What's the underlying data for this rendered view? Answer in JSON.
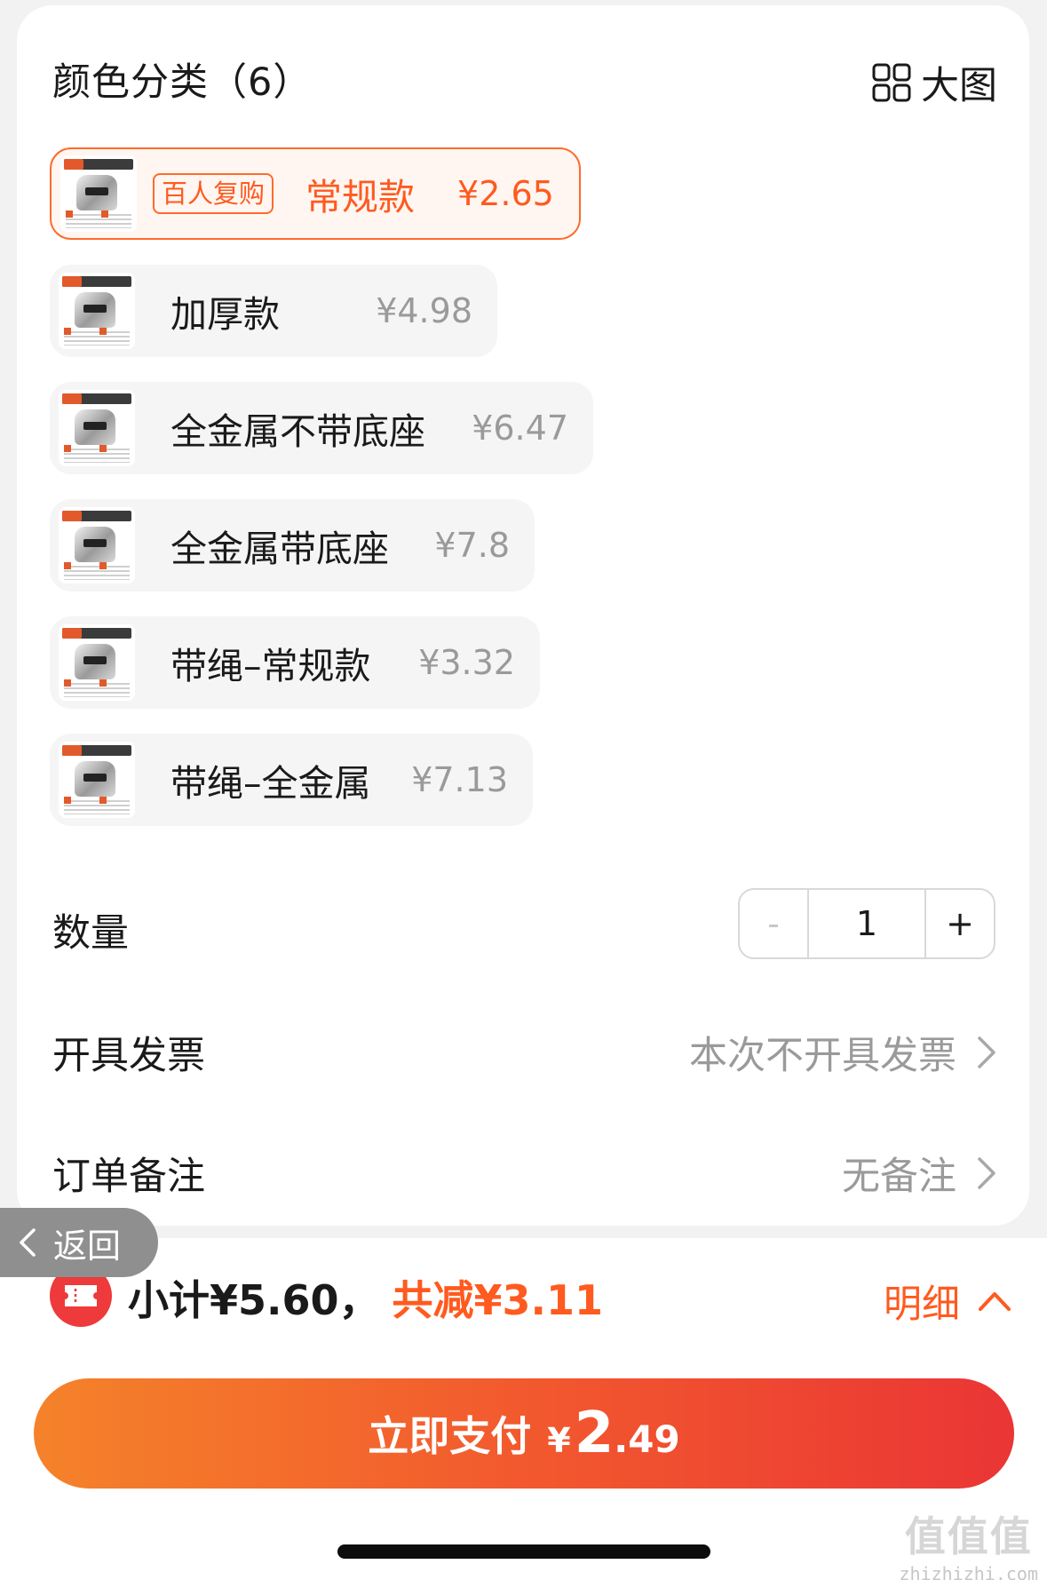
{
  "section": {
    "title": "颜色分类（6）",
    "big_view_label": "大图",
    "big_view_icon": "grid-icon"
  },
  "variants": [
    {
      "tag": "百人复购",
      "name": "常规款",
      "price": "¥2.65",
      "selected": true
    },
    {
      "tag": "",
      "name": "加厚款",
      "price": "¥4.98",
      "selected": false
    },
    {
      "tag": "",
      "name": "全金属不带底座",
      "price": "¥6.47",
      "selected": false
    },
    {
      "tag": "",
      "name": "全金属带底座",
      "price": "¥7.8",
      "selected": false
    },
    {
      "tag": "",
      "name": "带绳–常规款",
      "price": "¥3.32",
      "selected": false
    },
    {
      "tag": "",
      "name": "带绳–全金属",
      "price": "¥7.13",
      "selected": false
    }
  ],
  "quantity": {
    "label": "数量",
    "minus": "-",
    "value": "1",
    "plus": "+"
  },
  "invoice": {
    "label": "开具发票",
    "value": "本次不开具发票"
  },
  "remark": {
    "label": "订单备注",
    "value": "无备注"
  },
  "back": {
    "label": "返回"
  },
  "summary": {
    "subtotal": "小计¥5.60，",
    "discount": "共减¥3.11",
    "detail_label": "明细"
  },
  "pay": {
    "label": "立即支付",
    "yen": "¥",
    "amount_int": "2",
    "amount_dec": ".49"
  },
  "watermark": {
    "big": "值值值",
    "small": "zhizhizhi.com"
  },
  "colors": {
    "accent": "#ff5a1f",
    "pay_gradient_start": "#f5822a",
    "pay_gradient_end": "#ea3535",
    "coupon_red": "#ee3a3a"
  }
}
